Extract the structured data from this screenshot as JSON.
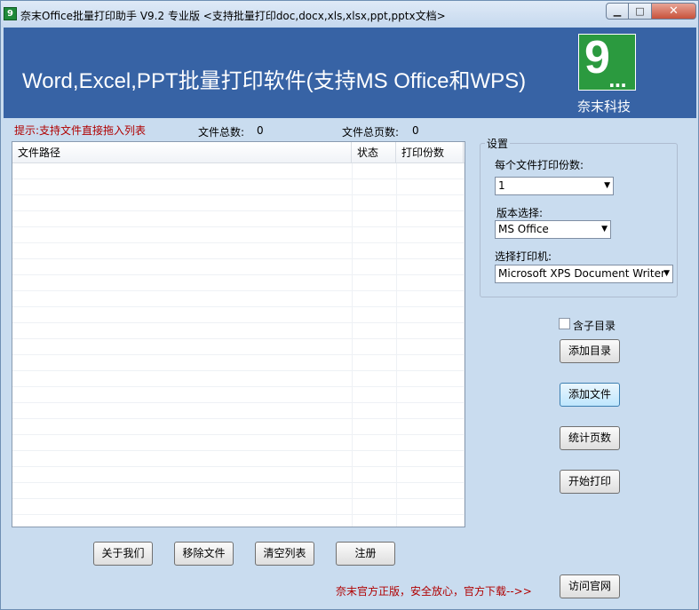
{
  "window": {
    "title": "奈末Office批量打印助手 V9.2  专业版  <支持批量打印doc,docx,xls,xlsx,ppt,pptx文档>",
    "app_icon_glyph": "9",
    "close_glyph": "✕",
    "min_glyph": "▁",
    "max_glyph": "□"
  },
  "banner": {
    "title": "Word,Excel,PPT批量打印软件(支持MS Office和WPS)",
    "logo_number": "9",
    "logo_dots": "...",
    "logo_caption": "奈末科技",
    "background": "#3763a5",
    "logo_color": "#2b9a3f"
  },
  "info": {
    "hint": "提示:支持文件直接拖入列表",
    "file_count_label": "文件总数:",
    "file_count": "0",
    "page_count_label": "文件总页数:",
    "page_count": "0"
  },
  "file_list": {
    "columns": [
      "文件路径",
      "状态",
      "打印份数"
    ],
    "rows": []
  },
  "settings": {
    "legend": "设置",
    "copies_label": "每个文件打印份数:",
    "copies_value": "1",
    "version_label": "版本选择:",
    "version_value": "MS Office",
    "printer_label": "选择打印机:",
    "printer_value": "Microsoft XPS Document Writer"
  },
  "actions": {
    "include_subdir_label": "含子目录",
    "add_dir": "添加目录",
    "add_file": "添加文件",
    "count_pages": "统计页数",
    "start_print": "开始打印",
    "visit_site": "访问官网"
  },
  "bottom_buttons": {
    "about": "关于我们",
    "remove_file": "移除文件",
    "clear_list": "清空列表",
    "register": "注册"
  },
  "footer_note": "奈末官方正版，安全放心，官方下载-->>"
}
